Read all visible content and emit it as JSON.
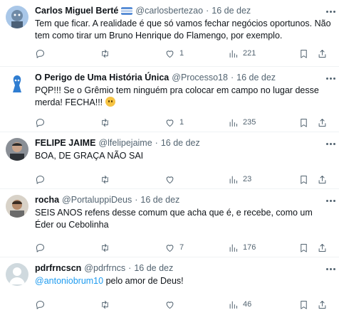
{
  "tweets": [
    {
      "name": "Carlos Miguel Berté",
      "handle": "@carlosbertezao",
      "date": "16 de dez",
      "text": "Tem que ficar. A realidade é que só vamos fechar negócios oportunos. Não tem como tirar um Bruno Henrique do Flamengo, por exemplo.",
      "replies": "",
      "retweets": "",
      "likes": "1",
      "views": "221",
      "has_flag": true
    },
    {
      "name": "O Perigo de Uma História Única",
      "handle": "@Processo18",
      "date": "16 de dez",
      "text": "PQP!!! Se o Grêmio tem ninguém pra colocar em campo no lugar desse merda! FECHA!!!",
      "replies": "",
      "retweets": "",
      "likes": "1",
      "views": "235"
    },
    {
      "name": "FELIPE JAIME",
      "handle": "@lfelipejaime",
      "date": "16 de dez",
      "text": "BOA, DE GRAÇA NÃO SAI",
      "replies": "",
      "retweets": "",
      "likes": "",
      "views": "23"
    },
    {
      "name": "rocha",
      "handle": "@PortaluppiDeus",
      "date": "16 de dez",
      "text": "SEIS ANOS refens desse comum que acha que é, e recebe, como um Éder ou Cebolinha",
      "replies": "",
      "retweets": "",
      "likes": "7",
      "views": "176"
    },
    {
      "name": "pdrfrncscn",
      "handle": "@pdrfrncs",
      "date": "16 de dez",
      "mention": "@antoniobrum10",
      "text": " pelo amor de Deus!",
      "replies": "",
      "retweets": "",
      "likes": "",
      "views": "46"
    }
  ],
  "colors": {
    "text": "#0f1419",
    "secondary": "#536471",
    "link": "#1d9bf0",
    "divider": "#eff3f4"
  },
  "icons": [
    "reply-icon",
    "retweet-icon",
    "like-icon",
    "views-icon",
    "bookmark-icon",
    "share-icon",
    "more-icon"
  ]
}
